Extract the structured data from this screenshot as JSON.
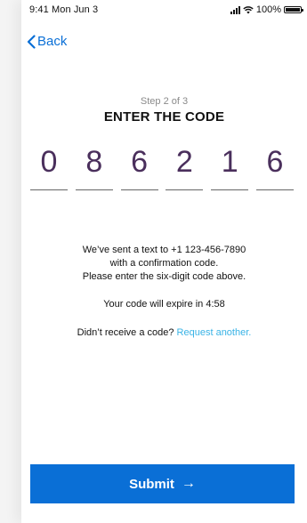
{
  "status_bar": {
    "time": "9:41",
    "date": "Mon Jun 3",
    "battery": "100%"
  },
  "nav": {
    "back_label": "Back"
  },
  "header": {
    "step": "Step 2 of 3",
    "title": "ENTER THE CODE"
  },
  "code": {
    "digits": [
      "0",
      "8",
      "6",
      "2",
      "1",
      "6"
    ]
  },
  "message": {
    "line1": "We’ve sent a text to +1 123-456-7890",
    "line2": "with a confirmation code.",
    "line3": "Please enter the six-digit code above."
  },
  "expiry": {
    "text": "Your code will expire in 4:58"
  },
  "resend": {
    "prompt": "Didn’t receive a code?",
    "link": "Request another."
  },
  "submit": {
    "label": "Submit",
    "arrow": "→"
  },
  "colors": {
    "accent": "#0a6fd6",
    "link": "#39b3e6",
    "digit": "#4a2f5c"
  }
}
